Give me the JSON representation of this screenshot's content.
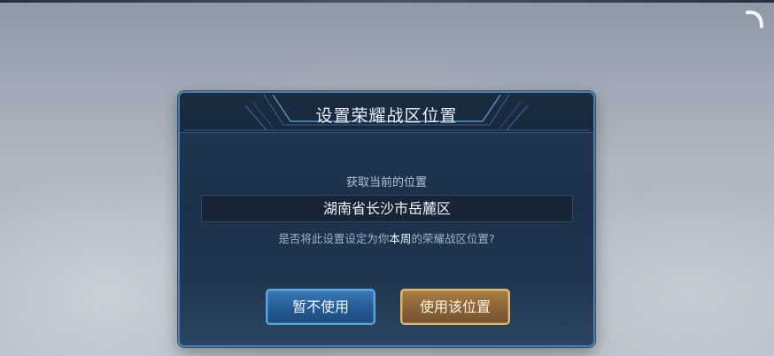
{
  "dialog": {
    "title": "设置荣耀战区位置",
    "location_label": "获取当前的位置",
    "location_value": "湖南省长沙市岳麓区",
    "question_prefix": "是否将此设置设定为你",
    "question_highlight": "本周",
    "question_suffix": "的荣耀战区位置?",
    "cancel_label": "暂不使用",
    "confirm_label": "使用该位置"
  },
  "icons": {
    "corner": "curved-arrow-icon"
  },
  "colors": {
    "dialog_border": "#4d7fb0",
    "cancel_button": "#245a93",
    "confirm_button": "#8a6236",
    "confirm_border": "#e3b870"
  }
}
